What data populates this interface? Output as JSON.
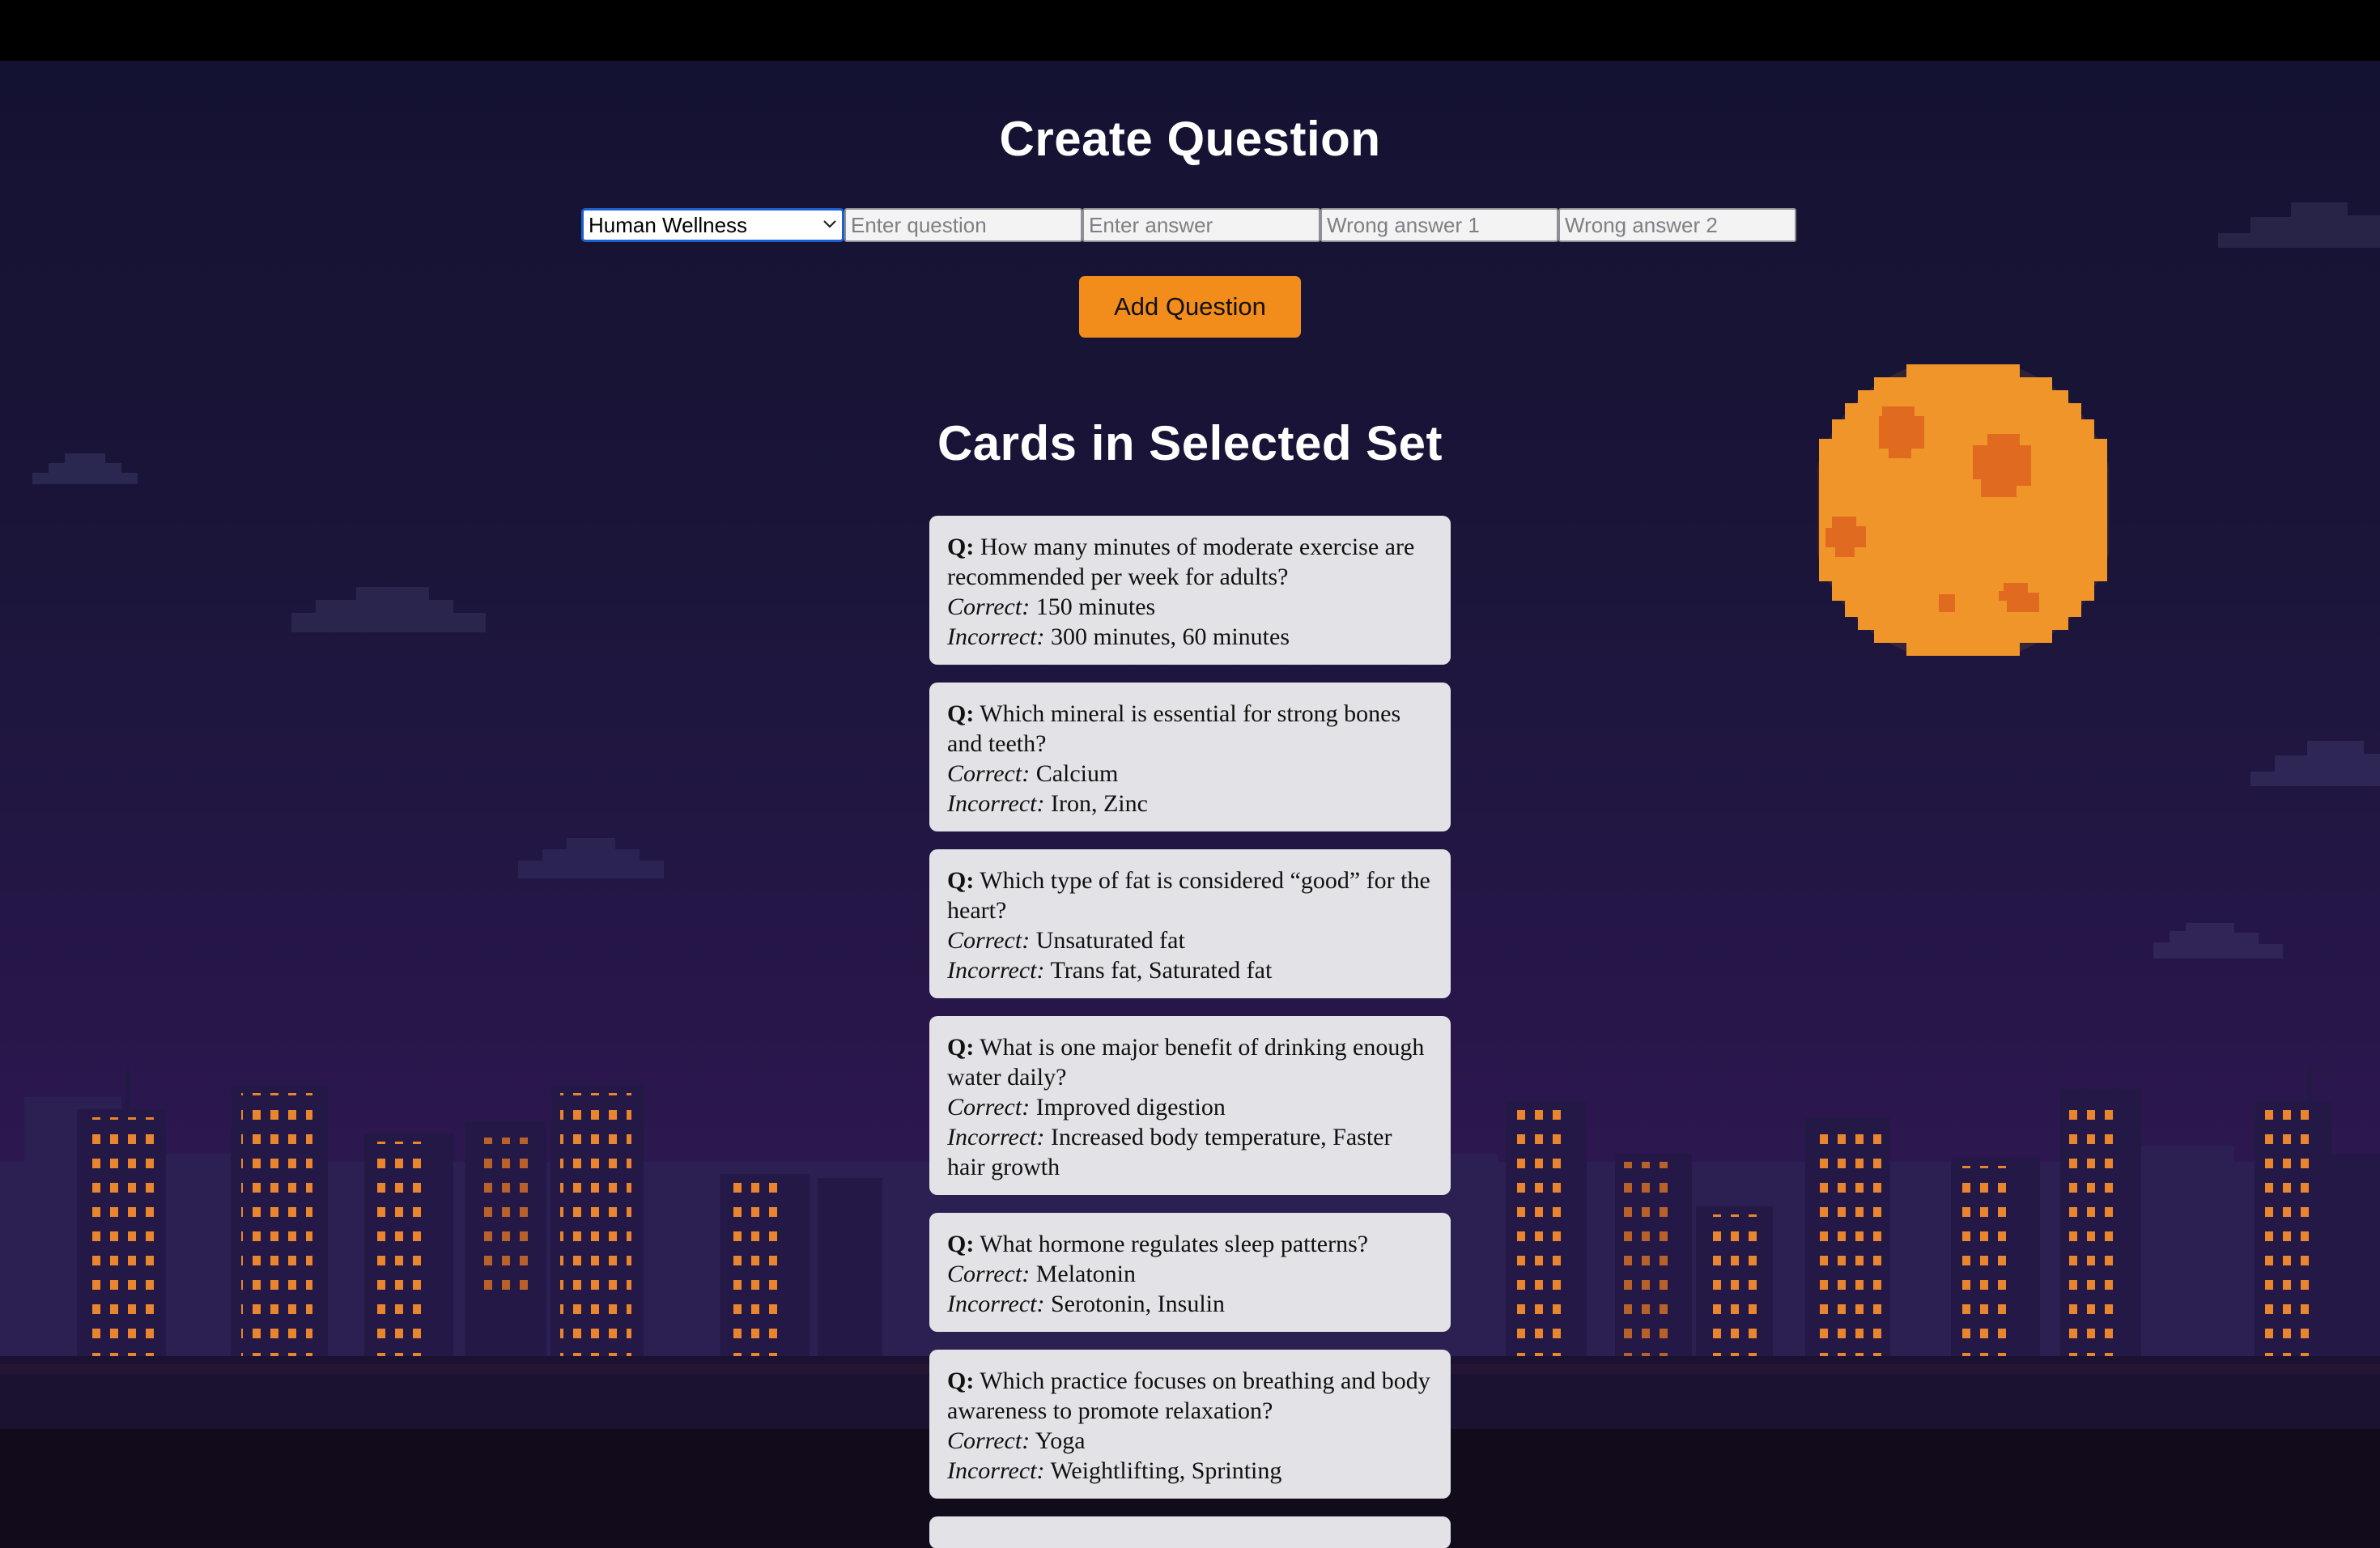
{
  "create": {
    "title": "Create Question",
    "set_select": {
      "selected": "Human Wellness"
    },
    "question_placeholder": "Enter question",
    "answer_placeholder": "Enter answer",
    "wrong1_placeholder": "Wrong answer 1",
    "wrong2_placeholder": "Wrong answer 2",
    "add_button": "Add Question"
  },
  "cards_section": {
    "title": "Cards in Selected Set",
    "q_label": "Q:",
    "correct_label": "Correct:",
    "incorrect_label": "Incorrect:",
    "cards": [
      {
        "question": "How many minutes of moderate exercise are recommended per week for adults?",
        "correct": "150 minutes",
        "incorrect": "300 minutes, 60 minutes"
      },
      {
        "question": "Which mineral is essential for strong bones and teeth?",
        "correct": "Calcium",
        "incorrect": "Iron, Zinc"
      },
      {
        "question": "Which type of fat is considered “good” for the heart?",
        "correct": "Unsaturated fat",
        "incorrect": "Trans fat, Saturated fat"
      },
      {
        "question": "What is one major benefit of drinking enough water daily?",
        "correct": "Improved digestion",
        "incorrect": "Increased body temperature, Faster hair growth"
      },
      {
        "question": "What hormone regulates sleep patterns?",
        "correct": "Melatonin",
        "incorrect": "Serotonin, Insulin"
      },
      {
        "question": "Which practice focuses on breathing and body awareness to promote relaxation?",
        "correct": "Yoga",
        "incorrect": "Weightlifting, Sprinting"
      }
    ]
  },
  "colors": {
    "accent_button": "#f28c1b",
    "card_bg": "#e3e2e7",
    "moon": "#f0952a",
    "moon_spots": "#e06a20",
    "window_light": "#e8852e"
  },
  "icons": {
    "select_chevron": "chevron-down-icon",
    "moon": "pixel-moon",
    "skyline": "pixel-city-skyline"
  }
}
